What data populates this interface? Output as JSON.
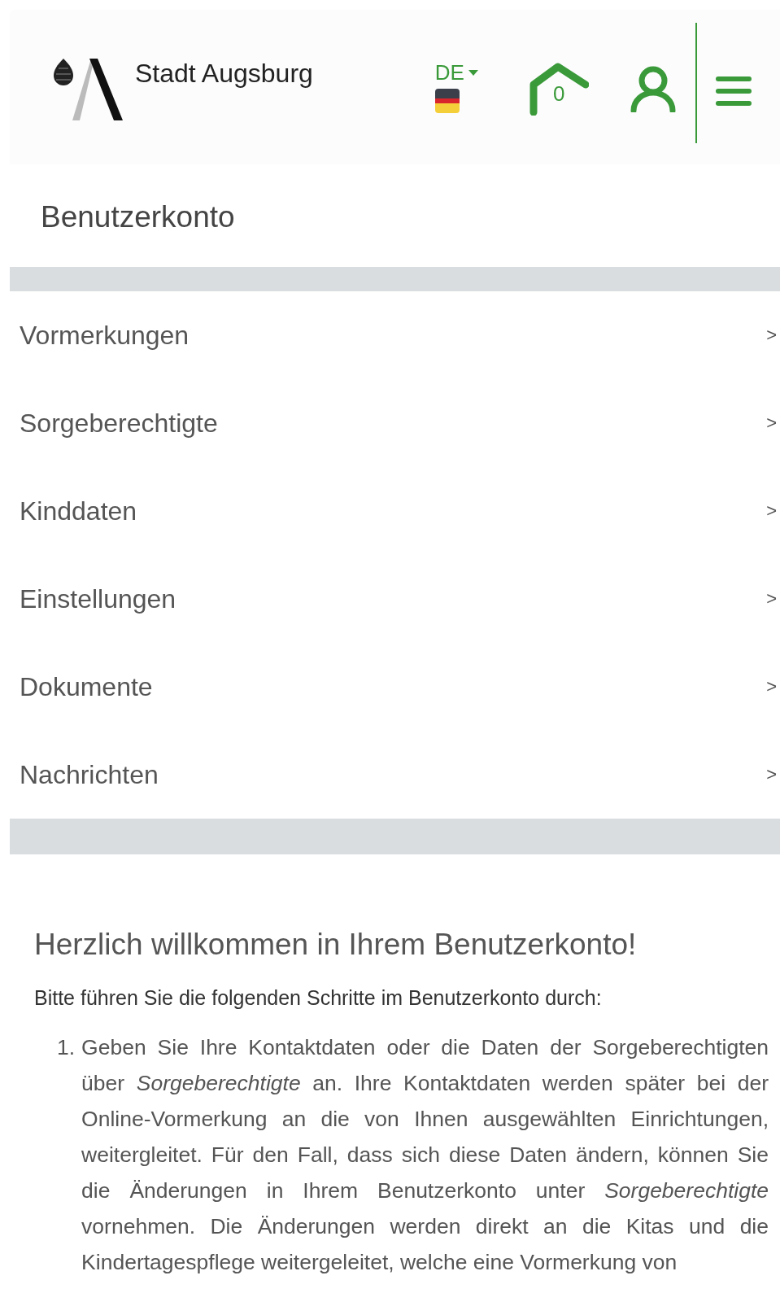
{
  "header": {
    "brand": "Stadt Augsburg",
    "language": "DE",
    "cart_count": "0"
  },
  "page_title": "Benutzerkonto",
  "menu": [
    {
      "label": "Vormerkungen",
      "chevron": ">"
    },
    {
      "label": "Sorgeberechtigte",
      "chevron": ">"
    },
    {
      "label": "Kinddaten",
      "chevron": ">"
    },
    {
      "label": "Einstellungen",
      "chevron": ">"
    },
    {
      "label": "Dokumente",
      "chevron": ">"
    },
    {
      "label": "Nachrichten",
      "chevron": ">"
    }
  ],
  "welcome": {
    "heading": "Herzlich willkommen in Ihrem Benutzerkonto!",
    "intro": "Bitte führen Sie die folgenden Schritte im Benutzerkonto durch:",
    "steps": [
      {
        "number": "1.",
        "text": "Geben Sie Ihre Kontaktdaten oder die Daten der Sorgeberechtigten über *Sorgeberechtigte* an. Ihre Kontaktdaten werden später bei der Online-Vormerkung an die von Ihnen ausgewählten Einrichtungen, weitergleitet. Für den Fall, dass sich diese Daten ändern, können Sie die Änderungen in Ihrem Benutzerkonto unter *Sorgeberechtigte* vornehmen. Die Änderungen werden direkt an die Kitas und die Kindertagespflege weitergeleitet, welche eine Vormerkung von"
      }
    ]
  }
}
